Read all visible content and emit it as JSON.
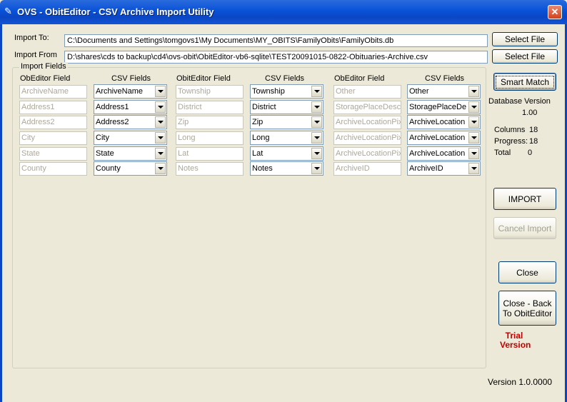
{
  "window": {
    "title": "OVS - ObitEditor - CSV Archive Import Utility",
    "close_glyph": "✕"
  },
  "import_to": {
    "label": "Import To:",
    "value": "C:\\Documents and Settings\\tomgovs1\\My Documents\\MY_OBITS\\FamilyObits\\FamilyObits.db",
    "button": "Select File"
  },
  "import_from": {
    "label": "Import From",
    "value": "D:\\shares\\cds to backup\\cd4\\ovs-obit\\ObitEditor-vb6-sqlite\\TEST20091015-0822-Obituaries-Archive.csv",
    "button": "Select File"
  },
  "group": {
    "legend": "Import Fields",
    "headers": [
      "ObEditor  Field",
      "CSV Fields",
      "ObitEditor  Field",
      "CSV Fields",
      "ObEditor  Field",
      "CSV Fields"
    ],
    "rows": [
      [
        "ArchiveName",
        "ArchiveName",
        "Township",
        "Township",
        "Other",
        "Other"
      ],
      [
        "Address1",
        "Address1",
        "District",
        "District",
        "StoragePlaceDesc",
        "StoragePlaceDe"
      ],
      [
        "Address2",
        "Address2",
        "Zip",
        "Zip",
        "ArchiveLocationPix",
        "ArchiveLocation"
      ],
      [
        "City",
        "City",
        "Long",
        "Long",
        "ArchiveLocationPix",
        "ArchiveLocation"
      ],
      [
        "State",
        "State",
        "Lat",
        "Lat",
        "ArchiveLocationPix",
        "ArchiveLocation"
      ],
      [
        "County",
        "County",
        "Notes",
        "Notes",
        "ArchiveID",
        "ArchiveID"
      ]
    ]
  },
  "right_panel": {
    "smart_match": "Smart Match",
    "db_version_label": "Database Version",
    "db_version_value": "1.00",
    "columns_label": "Columns",
    "columns_value": "18",
    "progress_label": "Progress:",
    "progress_value": "18",
    "total_label": "Total",
    "total_value": "0",
    "import": "IMPORT",
    "cancel_import": "Cancel Import",
    "close": "Close",
    "close_back_line1": "Close - Back",
    "close_back_line2": "To ObitEditor",
    "trial_line1": "Trial",
    "trial_line2": "Version"
  },
  "version": "Version 1.0.0000"
}
